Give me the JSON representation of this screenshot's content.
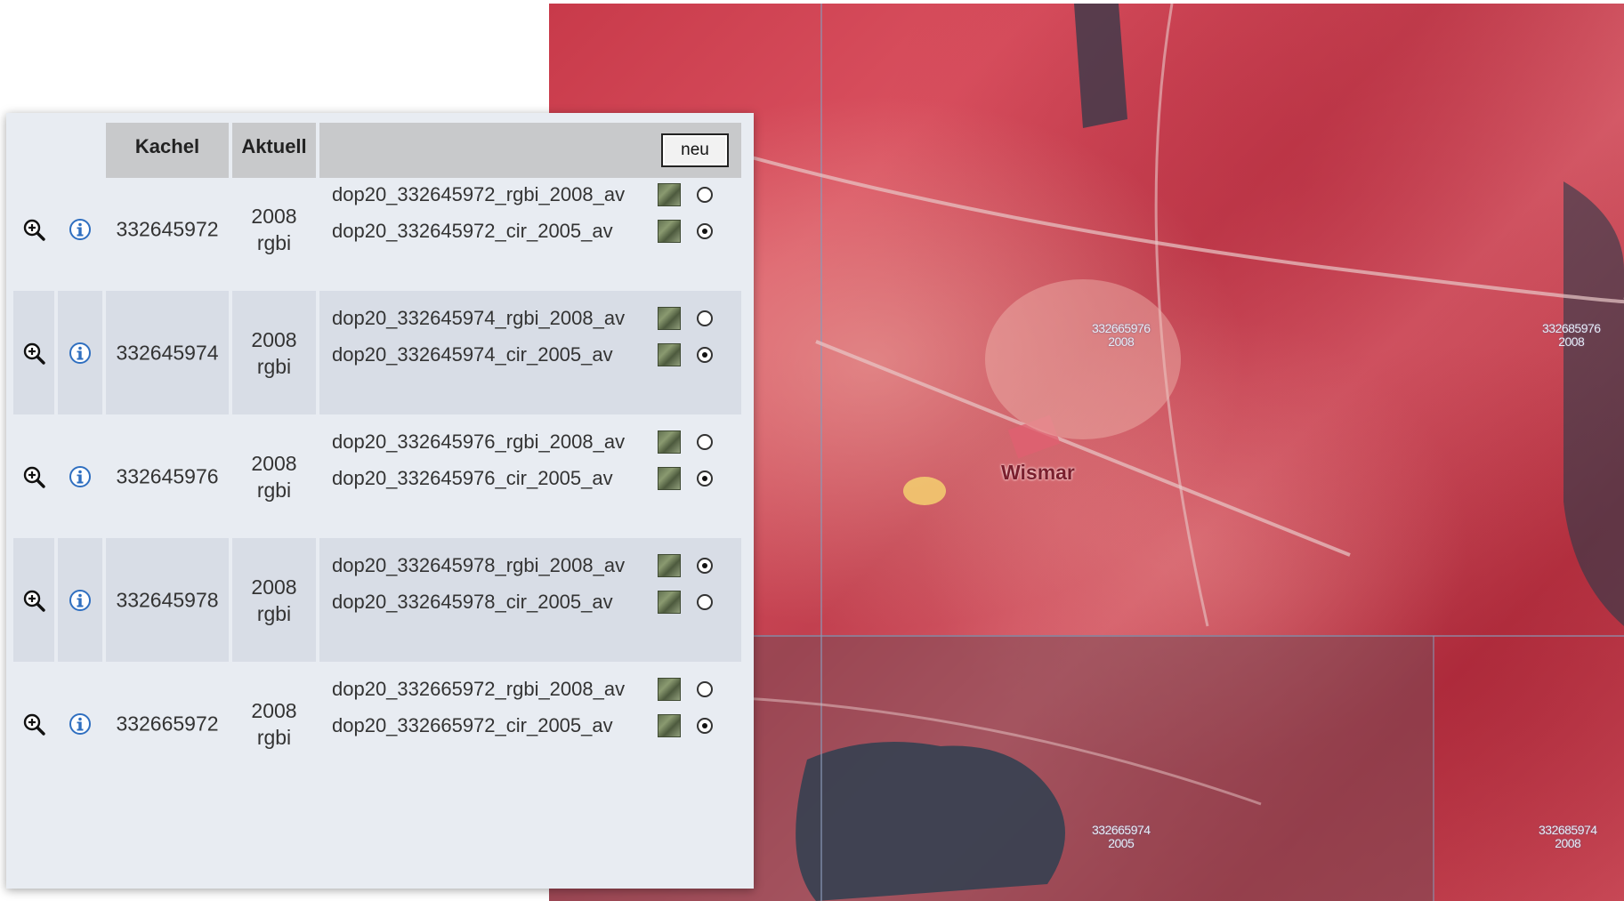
{
  "header": {
    "col_tile": "Kachel",
    "col_current": "Aktuell",
    "new_button": "neu"
  },
  "rows": [
    {
      "tile": "332645972",
      "year": "2008",
      "type": "rgbi",
      "files": [
        {
          "name": "dop20_332645972_rgbi_2008_av",
          "selected": false
        },
        {
          "name": "dop20_332645972_cir_2005_av",
          "selected": true
        }
      ]
    },
    {
      "tile": "332645974",
      "year": "2008",
      "type": "rgbi",
      "files": [
        {
          "name": "dop20_332645974_rgbi_2008_av",
          "selected": false
        },
        {
          "name": "dop20_332645974_cir_2005_av",
          "selected": true
        }
      ]
    },
    {
      "tile": "332645976",
      "year": "2008",
      "type": "rgbi",
      "files": [
        {
          "name": "dop20_332645976_rgbi_2008_av",
          "selected": false
        },
        {
          "name": "dop20_332645976_cir_2005_av",
          "selected": true
        }
      ]
    },
    {
      "tile": "332645978",
      "year": "2008",
      "type": "rgbi",
      "files": [
        {
          "name": "dop20_332645978_rgbi_2008_av",
          "selected": true
        },
        {
          "name": "dop20_332645978_cir_2005_av",
          "selected": false
        }
      ]
    },
    {
      "tile": "332665972",
      "year": "2008",
      "type": "rgbi",
      "files": [
        {
          "name": "dop20_332665972_rgbi_2008_av",
          "selected": false
        },
        {
          "name": "dop20_332665972_cir_2005_av",
          "selected": true
        }
      ]
    }
  ],
  "map": {
    "city": "Wismar",
    "tile_labels": [
      {
        "tile": "332665976",
        "year": "2008"
      },
      {
        "tile": "332685976",
        "year": "2008"
      },
      {
        "tile": "332665974",
        "year": "2005"
      },
      {
        "tile": "332685974",
        "year": "2008"
      }
    ]
  },
  "icons": {
    "zoom": "zoom-in-icon",
    "info": "info-icon",
    "thumbnail": "image-thumbnail-icon"
  },
  "colors": {
    "panel_bg": "#e8ecf2",
    "header_bg": "#c8c9cb",
    "info_blue": "#2f6fc0",
    "map_red": "#c83a4a"
  }
}
